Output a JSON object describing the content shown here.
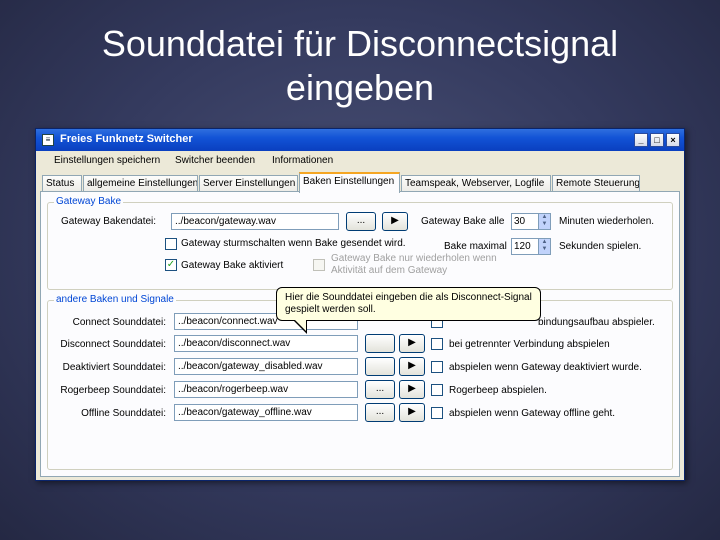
{
  "slide": {
    "title_line1": "Sounddatei für Disconnectsignal",
    "title_line2": "eingeben"
  },
  "window": {
    "title": "Freies Funknetz Switcher",
    "icon": "app-icon",
    "controls": {
      "minimize": "_",
      "maximize": "□",
      "close": "×"
    }
  },
  "menu": [
    "Einstellungen speichern",
    "Switcher beenden",
    "Informationen"
  ],
  "tabs": [
    "Status",
    "allgemeine Einstellungen",
    "Server Einstellungen",
    "Baken Einstellungen",
    "Teamspeak, Webserver, Logfile",
    "Remote Steuerung"
  ],
  "active_tab": 3,
  "gateway_bake": {
    "legend": "Gateway Bake",
    "file_label": "Gateway Bakendatei:",
    "file_value": "../beacon/gateway.wav",
    "browse_label": "...",
    "play_label": "▶",
    "interval_label": "Gateway Bake alle",
    "interval_value": "30",
    "interval_unit": "Minuten wiederholen.",
    "max_label": "Bake maximal",
    "max_value": "120",
    "max_unit": "Sekunden spielen.",
    "check_transmit": {
      "label": "Gateway sturmschalten wenn Bake gesendet wird.",
      "checked": false
    },
    "check_active": {
      "label": "Gateway Bake aktiviert",
      "checked": true
    },
    "check_repeat": {
      "label_line1": "Gateway Bake nur wiederholen wenn",
      "label_line2": "Aktivität auf dem Gateway",
      "checked": false
    }
  },
  "other_sounds": {
    "legend": "andere Baken und Signale",
    "rows": [
      {
        "label": "Connect Sounddatei:",
        "value": "../beacon/connect.wav",
        "check_label": "bindungsaufbau abspieler."
      },
      {
        "label": "Disconnect Sounddatei:",
        "value": "../beacon/disconnect.wav",
        "check_label": "bei getrennter Verbindung abspielen"
      },
      {
        "label": "Deaktiviert Sounddatei:",
        "value": "../beacon/gateway_disabled.wav",
        "check_label": "abspielen wenn Gateway deaktiviert wurde."
      },
      {
        "label": "Rogerbeep Sounddatei:",
        "value": "../beacon/rogerbeep.wav",
        "check_label": "Rogerbeep abspielen."
      },
      {
        "label": "Offline Sounddatei:",
        "value": "../beacon/gateway_offline.wav",
        "check_label": "abspielen wenn Gateway offline geht."
      }
    ],
    "browse_label": "...",
    "play_label": "▶"
  },
  "tooltip": {
    "line1": "Hier die Sounddatei eingeben die als Disconnect-Signal",
    "line2": "gespielt werden soll."
  }
}
